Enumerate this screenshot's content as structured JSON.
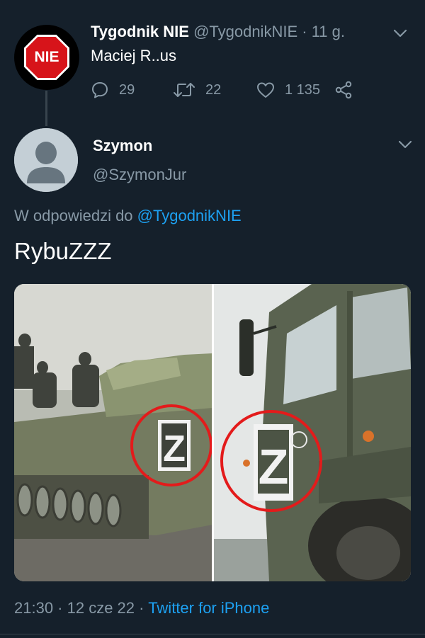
{
  "parent_tweet": {
    "author_name": "Tygodnik NIE",
    "author_handle": "@TygodnikNIE",
    "separator": "·",
    "time": "11 g.",
    "text": "Maciej R..us",
    "avatar_text": "NIE",
    "replies": "29",
    "retweets": "22",
    "likes": "1 135"
  },
  "reply_tweet": {
    "author_name": "Szymon",
    "author_handle": "@SzymonJur",
    "reply_prefix": "W odpowiedzi do",
    "reply_mention": "@TygodnikNIE",
    "text": "RybuZZZ",
    "timestamp": "21:30 · 12 cze 22",
    "separator": "·",
    "source": "Twitter for iPhone",
    "media_mark_left": "Z",
    "media_mark_right": "Z"
  },
  "colors": {
    "background": "#15202b",
    "muted_text": "#8899a6",
    "link": "#1da1f2",
    "divider": "#38444d",
    "nie_red": "#d7141a",
    "highlight_circle": "#e31b1b"
  },
  "icons": [
    "chevron-down-icon",
    "reply-icon",
    "retweet-icon",
    "like-icon",
    "share-icon"
  ]
}
